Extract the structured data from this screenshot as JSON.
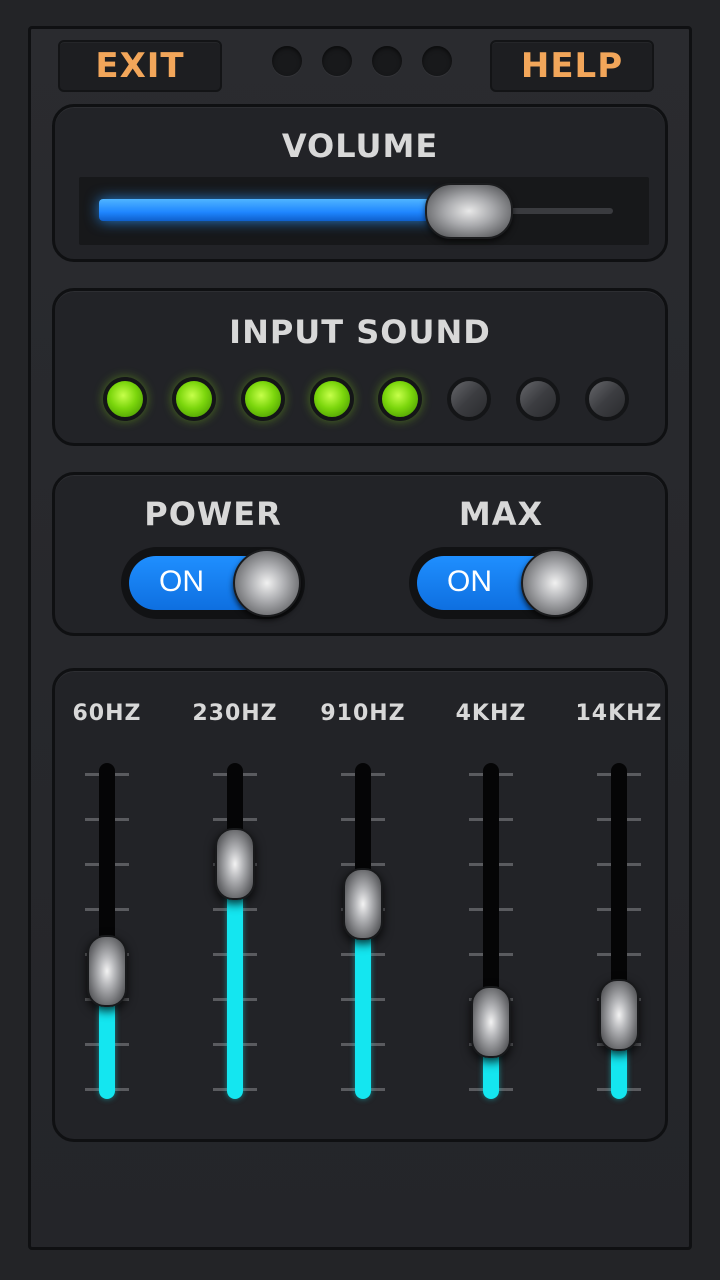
{
  "header": {
    "exit_label": "EXIT",
    "help_label": "HELP",
    "indicator_dots": 4
  },
  "volume": {
    "title": "VOLUME",
    "level": 0.72
  },
  "input_sound": {
    "title": "INPUT SOUND",
    "leds": [
      true,
      true,
      true,
      true,
      true,
      false,
      false,
      false
    ]
  },
  "switches": {
    "power": {
      "label": "POWER",
      "state": "ON"
    },
    "max": {
      "label": "MAX",
      "state": "ON"
    }
  },
  "equalizer": {
    "bands": [
      {
        "label": "60HZ",
        "level": 0.38
      },
      {
        "label": "230HZ",
        "level": 0.7
      },
      {
        "label": "910HZ",
        "level": 0.58
      },
      {
        "label": "4KHZ",
        "level": 0.23
      },
      {
        "label": "14KHZ",
        "level": 0.25
      }
    ]
  },
  "colors": {
    "accent_orange": "#f2a65a",
    "volume_blue": "#1f86ff",
    "led_green": "#7bd60c",
    "eq_cyan": "#14e6f0"
  }
}
